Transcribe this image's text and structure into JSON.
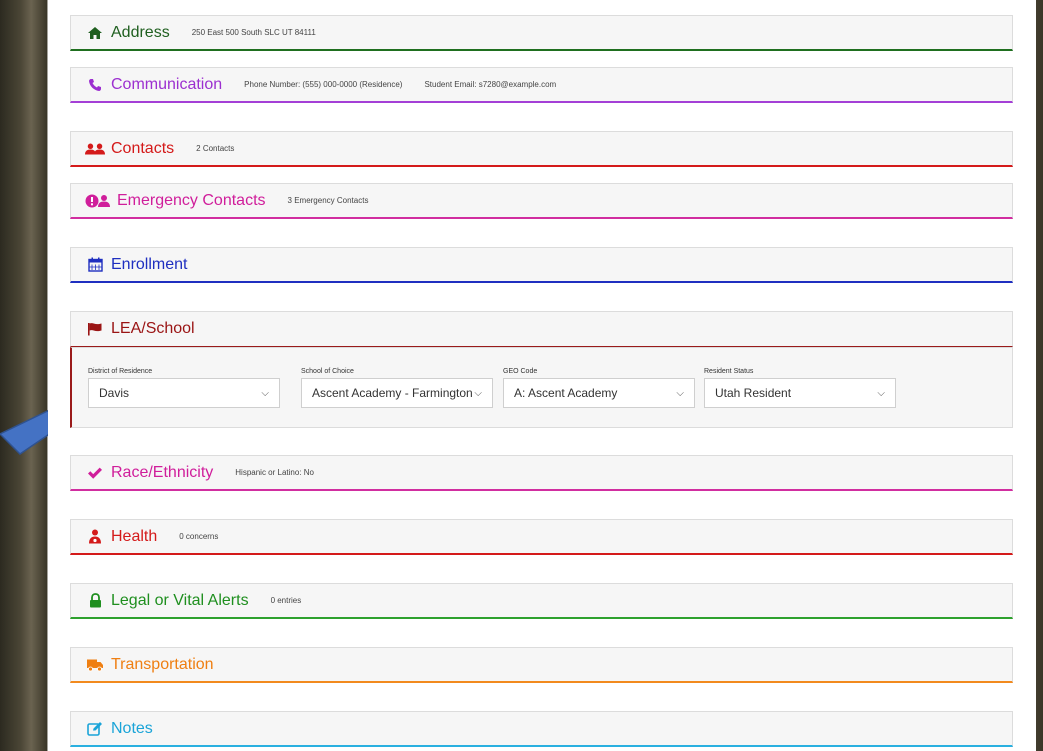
{
  "sections": {
    "address": {
      "title": "Address",
      "summary": "250 East 500 South SLC UT 84111",
      "color": "#1f5f1f",
      "icon": "home-icon"
    },
    "communication": {
      "title": "Communication",
      "phone": "Phone Number: (555) 000-0000 (Residence)",
      "email": "Student Email: s7280@example.com",
      "color": "#9c2fd0",
      "icon": "phone-icon"
    },
    "contacts": {
      "title": "Contacts",
      "summary": "2 Contacts",
      "color": "#d41a1a",
      "icon": "users-icon"
    },
    "emergency": {
      "title": "Emergency Contacts",
      "summary": "3 Emergency Contacts",
      "color": "#d01e9b",
      "icon": "alert-user-icon"
    },
    "enrollment": {
      "title": "Enrollment",
      "color": "#1f2fc0",
      "icon": "calendar-icon"
    },
    "lea": {
      "title": "LEA/School",
      "color": "#9a1414",
      "icon": "flag-icon",
      "fields": {
        "district": {
          "label": "District of Residence",
          "value": "Davis"
        },
        "school": {
          "label": "School of Choice",
          "value": "Ascent Academy - Farmington"
        },
        "geo": {
          "label": "GEO Code",
          "value": "A: Ascent Academy"
        },
        "resident": {
          "label": "Resident Status",
          "value": "Utah Resident"
        }
      }
    },
    "race": {
      "title": "Race/Ethnicity",
      "summary": "Hispanic or Latino: No",
      "color": "#d01e9b",
      "icon": "check-icon"
    },
    "health": {
      "title": "Health",
      "summary": "0 concerns",
      "color": "#d41a1a",
      "icon": "medical-user-icon"
    },
    "legal": {
      "title": "Legal or Vital Alerts",
      "summary": "0 entries",
      "color": "#1f8f1f",
      "icon": "lock-icon"
    },
    "transportation": {
      "title": "Transportation",
      "color": "#ef7f12",
      "icon": "truck-icon"
    },
    "notes": {
      "title": "Notes",
      "color": "#1aa4d8",
      "icon": "edit-icon"
    }
  }
}
